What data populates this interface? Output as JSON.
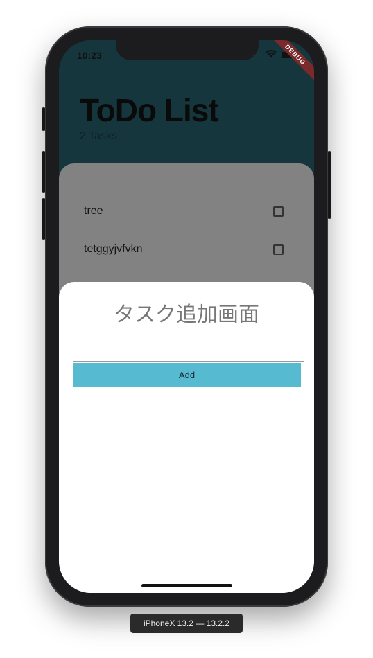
{
  "status_bar": {
    "time": "10:23",
    "signal": "....",
    "debug_label": "DEBUG"
  },
  "header": {
    "title": "ToDo List",
    "subtitle": "2 Tasks"
  },
  "tasks": [
    {
      "label": "tree",
      "checked": false
    },
    {
      "label": "tetggyjvfvkn",
      "checked": false
    }
  ],
  "add_sheet": {
    "title": "タスク追加画面",
    "input_value": "",
    "add_label": "Add"
  },
  "simulator": {
    "device_label": "iPhoneX 13.2 — 13.2.2"
  },
  "colors": {
    "header_bg": "#245a66",
    "accent": "#56bad1",
    "frame": "#1c1c1e"
  },
  "icons": [
    "wifi-icon",
    "battery-icon",
    "checkbox-icon"
  ]
}
